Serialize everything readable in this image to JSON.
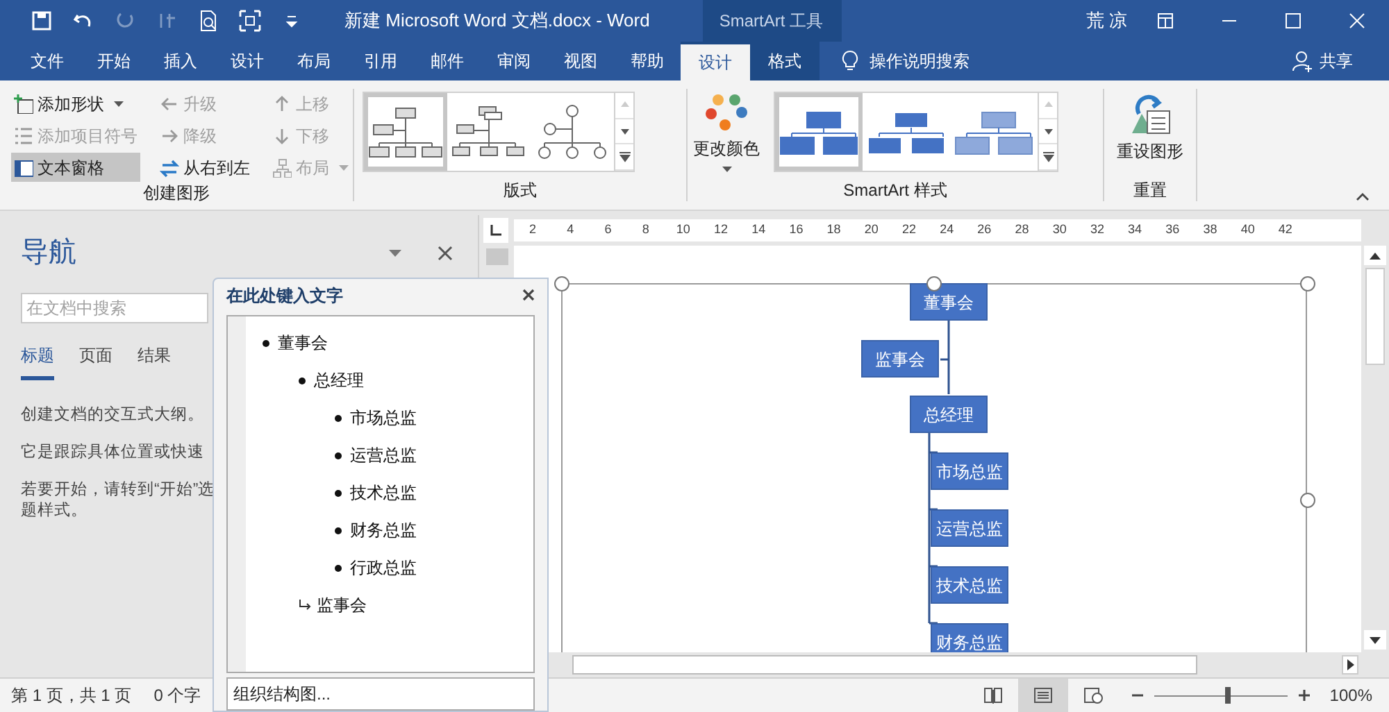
{
  "title_bar": {
    "title": "新建 Microsoft Word 文档.docx  -  Word",
    "context_label": "SmartArt 工具",
    "user": "荒 凉"
  },
  "tabs": [
    {
      "label": "文件",
      "selected": false,
      "kind": "normal"
    },
    {
      "label": "开始",
      "selected": false,
      "kind": "normal"
    },
    {
      "label": "插入",
      "selected": false,
      "kind": "normal"
    },
    {
      "label": "设计",
      "selected": false,
      "kind": "normal"
    },
    {
      "label": "布局",
      "selected": false,
      "kind": "normal"
    },
    {
      "label": "引用",
      "selected": false,
      "kind": "normal"
    },
    {
      "label": "邮件",
      "selected": false,
      "kind": "normal"
    },
    {
      "label": "审阅",
      "selected": false,
      "kind": "normal"
    },
    {
      "label": "视图",
      "selected": false,
      "kind": "normal"
    },
    {
      "label": "帮助",
      "selected": false,
      "kind": "normal"
    },
    {
      "label": "设计",
      "selected": true,
      "kind": "context"
    },
    {
      "label": "格式",
      "selected": false,
      "kind": "context"
    }
  ],
  "tell_me": "操作说明搜索",
  "share": "共享",
  "ribbon": {
    "create_group": {
      "label": "创建图形",
      "buttons": [
        {
          "label": "添加形状",
          "kind": "add-shape",
          "disabled": false,
          "selected": false,
          "dropdown": true
        },
        {
          "label": "升级",
          "kind": "promote",
          "disabled": true,
          "selected": false,
          "dropdown": false
        },
        {
          "label": "上移",
          "kind": "move-up",
          "disabled": true,
          "selected": false,
          "dropdown": false
        },
        {
          "label": "添加项目符号",
          "kind": "bullets",
          "disabled": true,
          "selected": false,
          "dropdown": false
        },
        {
          "label": "降级",
          "kind": "demote",
          "disabled": true,
          "selected": false,
          "dropdown": false
        },
        {
          "label": "下移",
          "kind": "move-down",
          "disabled": true,
          "selected": false,
          "dropdown": false
        },
        {
          "label": "文本窗格",
          "kind": "pane",
          "disabled": false,
          "selected": true,
          "dropdown": false
        },
        {
          "label": "从右到左",
          "kind": "swap",
          "disabled": false,
          "selected": false,
          "dropdown": false
        },
        {
          "label": "布局",
          "kind": "layout",
          "disabled": true,
          "selected": false,
          "dropdown": true
        }
      ]
    },
    "layouts_group": {
      "label": "版式",
      "items": [
        {
          "kind": "org",
          "selected": true
        },
        {
          "kind": "name-title",
          "selected": false
        },
        {
          "kind": "circle",
          "selected": false
        }
      ]
    },
    "color_button": "更改颜色",
    "styles_group": {
      "label": "SmartArt 样式",
      "items": [
        {
          "kind": "flat",
          "selected": true
        },
        {
          "kind": "outlined",
          "selected": false
        },
        {
          "kind": "soft",
          "selected": false
        }
      ]
    },
    "reset_group": {
      "label": "重置",
      "button": "重设图形"
    }
  },
  "nav_pane": {
    "title": "导航",
    "search_placeholder": "在文档中搜索",
    "tabs": [
      {
        "label": "标题",
        "selected": true
      },
      {
        "label": "页面",
        "selected": false
      },
      {
        "label": "结果",
        "selected": false
      }
    ],
    "paragraphs": [
      [
        "创建文档的交互式大纲。"
      ],
      [
        "它是跟踪具体位置或快速"
      ],
      [
        "若要开始，请转到“开始”选",
        "题样式。"
      ]
    ]
  },
  "ruler": [
    "2",
    "4",
    "6",
    "8",
    "10",
    "12",
    "14",
    "16",
    "18",
    "20",
    "22",
    "24",
    "26",
    "28",
    "30",
    "32",
    "34",
    "36",
    "38",
    "40",
    "42"
  ],
  "text_pane": {
    "title": "在此处键入文字",
    "items": [
      {
        "text": "董事会",
        "kind": "bullet",
        "children": [
          {
            "text": "总经理",
            "kind": "bullet",
            "children": [
              {
                "text": "市场总监",
                "kind": "bullet"
              },
              {
                "text": "运营总监",
                "kind": "bullet"
              },
              {
                "text": "技术总监",
                "kind": "bullet"
              },
              {
                "text": "财务总监",
                "kind": "bullet"
              },
              {
                "text": "行政总监",
                "kind": "bullet"
              }
            ]
          },
          {
            "text": "监事会",
            "kind": "assistant"
          }
        ]
      }
    ],
    "footer": "组织结构图..."
  },
  "diagram": {
    "top": "董事会",
    "assistant": "监事会",
    "manager": "总经理",
    "reports": [
      "市场总监",
      "运营总监",
      "技术总监",
      "财务总监"
    ]
  },
  "status_bar": {
    "page": "第 1 页，共 1 页",
    "words": "0 个字",
    "zoom": "100%",
    "zoom_slider": {
      "level": 0.55
    }
  }
}
